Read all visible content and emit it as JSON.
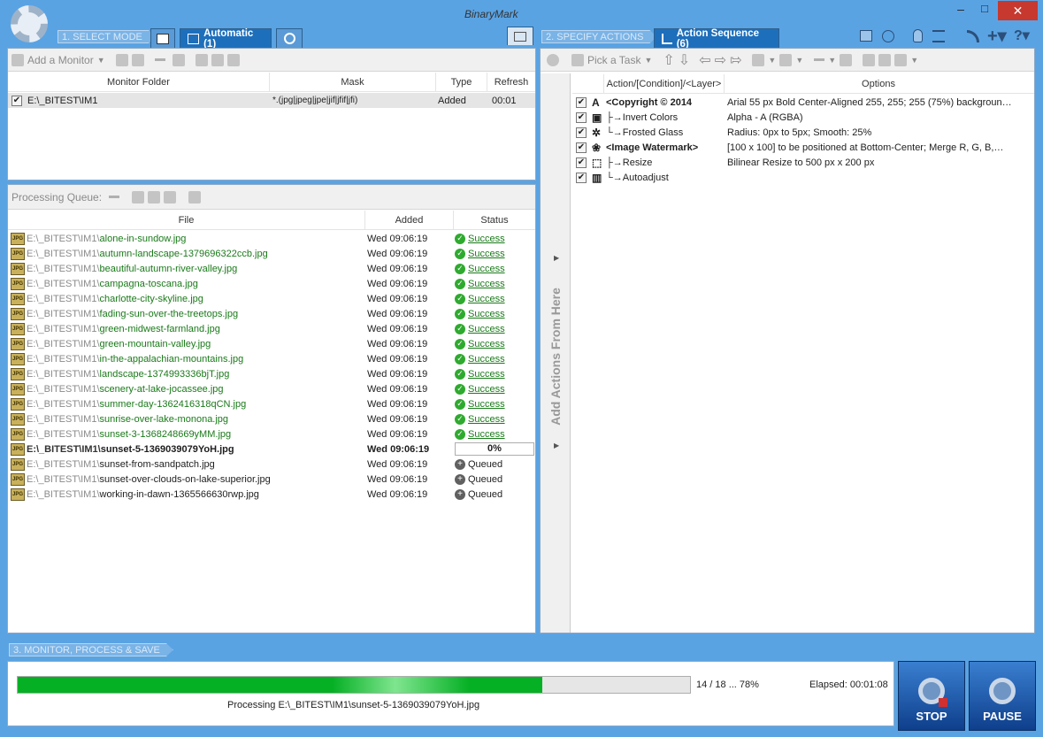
{
  "app": {
    "logo": "BinaryMark"
  },
  "section1": {
    "crumb": "1. SELECT MODE",
    "tab_active": "Automatic (1)"
  },
  "section2": {
    "crumb": "2. SPECIFY ACTIONS",
    "tab_active": "Action Sequence (6)"
  },
  "section3": {
    "crumb": "3. MONITOR, PROCESS & SAVE"
  },
  "monitor": {
    "add_label": "Add a Monitor",
    "headers": [
      "Monitor Folder",
      "Mask",
      "Type",
      "Refresh"
    ],
    "rows": [
      {
        "checked": true,
        "folder": "E:\\_BITEST\\IM1",
        "mask": "*.(jpg|jpeg|jpe|jif|jfif|jfi)",
        "type": "Added",
        "refresh": "00:01"
      }
    ]
  },
  "queue": {
    "label": "Processing Queue:",
    "headers": [
      "File",
      "Added",
      "Status"
    ],
    "prefix": "E:\\_BITEST\\IM1\\",
    "rows": [
      {
        "name": "alone-in-sundow.jpg",
        "added": "Wed 09:06:19",
        "status": "Success"
      },
      {
        "name": "autumn-landscape-1379696322ccb.jpg",
        "added": "Wed 09:06:19",
        "status": "Success"
      },
      {
        "name": "beautiful-autumn-river-valley.jpg",
        "added": "Wed 09:06:19",
        "status": "Success"
      },
      {
        "name": "campagna-toscana.jpg",
        "added": "Wed 09:06:19",
        "status": "Success"
      },
      {
        "name": "charlotte-city-skyline.jpg",
        "added": "Wed 09:06:19",
        "status": "Success"
      },
      {
        "name": "fading-sun-over-the-treetops.jpg",
        "added": "Wed 09:06:19",
        "status": "Success"
      },
      {
        "name": "green-midwest-farmland.jpg",
        "added": "Wed 09:06:19",
        "status": "Success"
      },
      {
        "name": "green-mountain-valley.jpg",
        "added": "Wed 09:06:19",
        "status": "Success"
      },
      {
        "name": "in-the-appalachian-mountains.jpg",
        "added": "Wed 09:06:19",
        "status": "Success"
      },
      {
        "name": "landscape-1374993336bjT.jpg",
        "added": "Wed 09:06:19",
        "status": "Success"
      },
      {
        "name": "scenery-at-lake-jocassee.jpg",
        "added": "Wed 09:06:19",
        "status": "Success"
      },
      {
        "name": "summer-day-1362416318qCN.jpg",
        "added": "Wed 09:06:19",
        "status": "Success"
      },
      {
        "name": "sunrise-over-lake-monona.jpg",
        "added": "Wed 09:06:19",
        "status": "Success"
      },
      {
        "name": "sunset-3-1368248669yMM.jpg",
        "added": "Wed 09:06:19",
        "status": "Success"
      },
      {
        "name": "sunset-5-1369039079YoH.jpg",
        "added": "Wed 09:06:19",
        "status": "0%"
      },
      {
        "name": "sunset-from-sandpatch.jpg",
        "added": "Wed 09:06:19",
        "status": "Queued"
      },
      {
        "name": "sunset-over-clouds-on-lake-superior.jpg",
        "added": "Wed 09:06:19",
        "status": "Queued"
      },
      {
        "name": "working-in-dawn-1365566630rwp.jpg",
        "added": "Wed 09:06:19",
        "status": "Queued"
      }
    ]
  },
  "actions": {
    "pick_label": "Pick a Task",
    "headers": [
      "Action/[Condition]/<Layer>",
      "Options"
    ],
    "side_label": "Add Actions From Here",
    "rows": [
      {
        "icon": "A",
        "tree": "",
        "name": "<Copyright © 2014",
        "bold": true,
        "options": "Arial  55 px  Bold  Center-Aligned  255,  255;  255  (75%)  backgroun…"
      },
      {
        "icon": "▣",
        "tree": "├→ ",
        "name": "Invert Colors",
        "bold": false,
        "options": "Alpha - A (RGBA)"
      },
      {
        "icon": "✲",
        "tree": "└→ ",
        "name": "Frosted Glass",
        "bold": false,
        "options": "Radius: 0px to 5px; Smooth: 25%"
      },
      {
        "icon": "❀",
        "tree": "",
        "name": "<Image Watermark>",
        "bold": true,
        "options": "[100 x 100] to be positioned at Bottom-Center; Merge R, G, B,…"
      },
      {
        "icon": "⬚",
        "tree": "├→ ",
        "name": "Resize",
        "bold": false,
        "options": "Bilinear Resize to 500 px x 200 px"
      },
      {
        "icon": "▥",
        "tree": "└→ ",
        "name": "Autoadjust",
        "bold": false,
        "options": ""
      }
    ]
  },
  "progress": {
    "fraction": 0.78,
    "count_text": "14 / 18 ... 78%",
    "elapsed_text": "Elapsed: 00:01:08",
    "processing_text": "Processing E:\\_BITEST\\IM1\\sunset-5-1369039079YoH.jpg"
  },
  "buttons": {
    "stop": "STOP",
    "pause": "PAUSE"
  }
}
